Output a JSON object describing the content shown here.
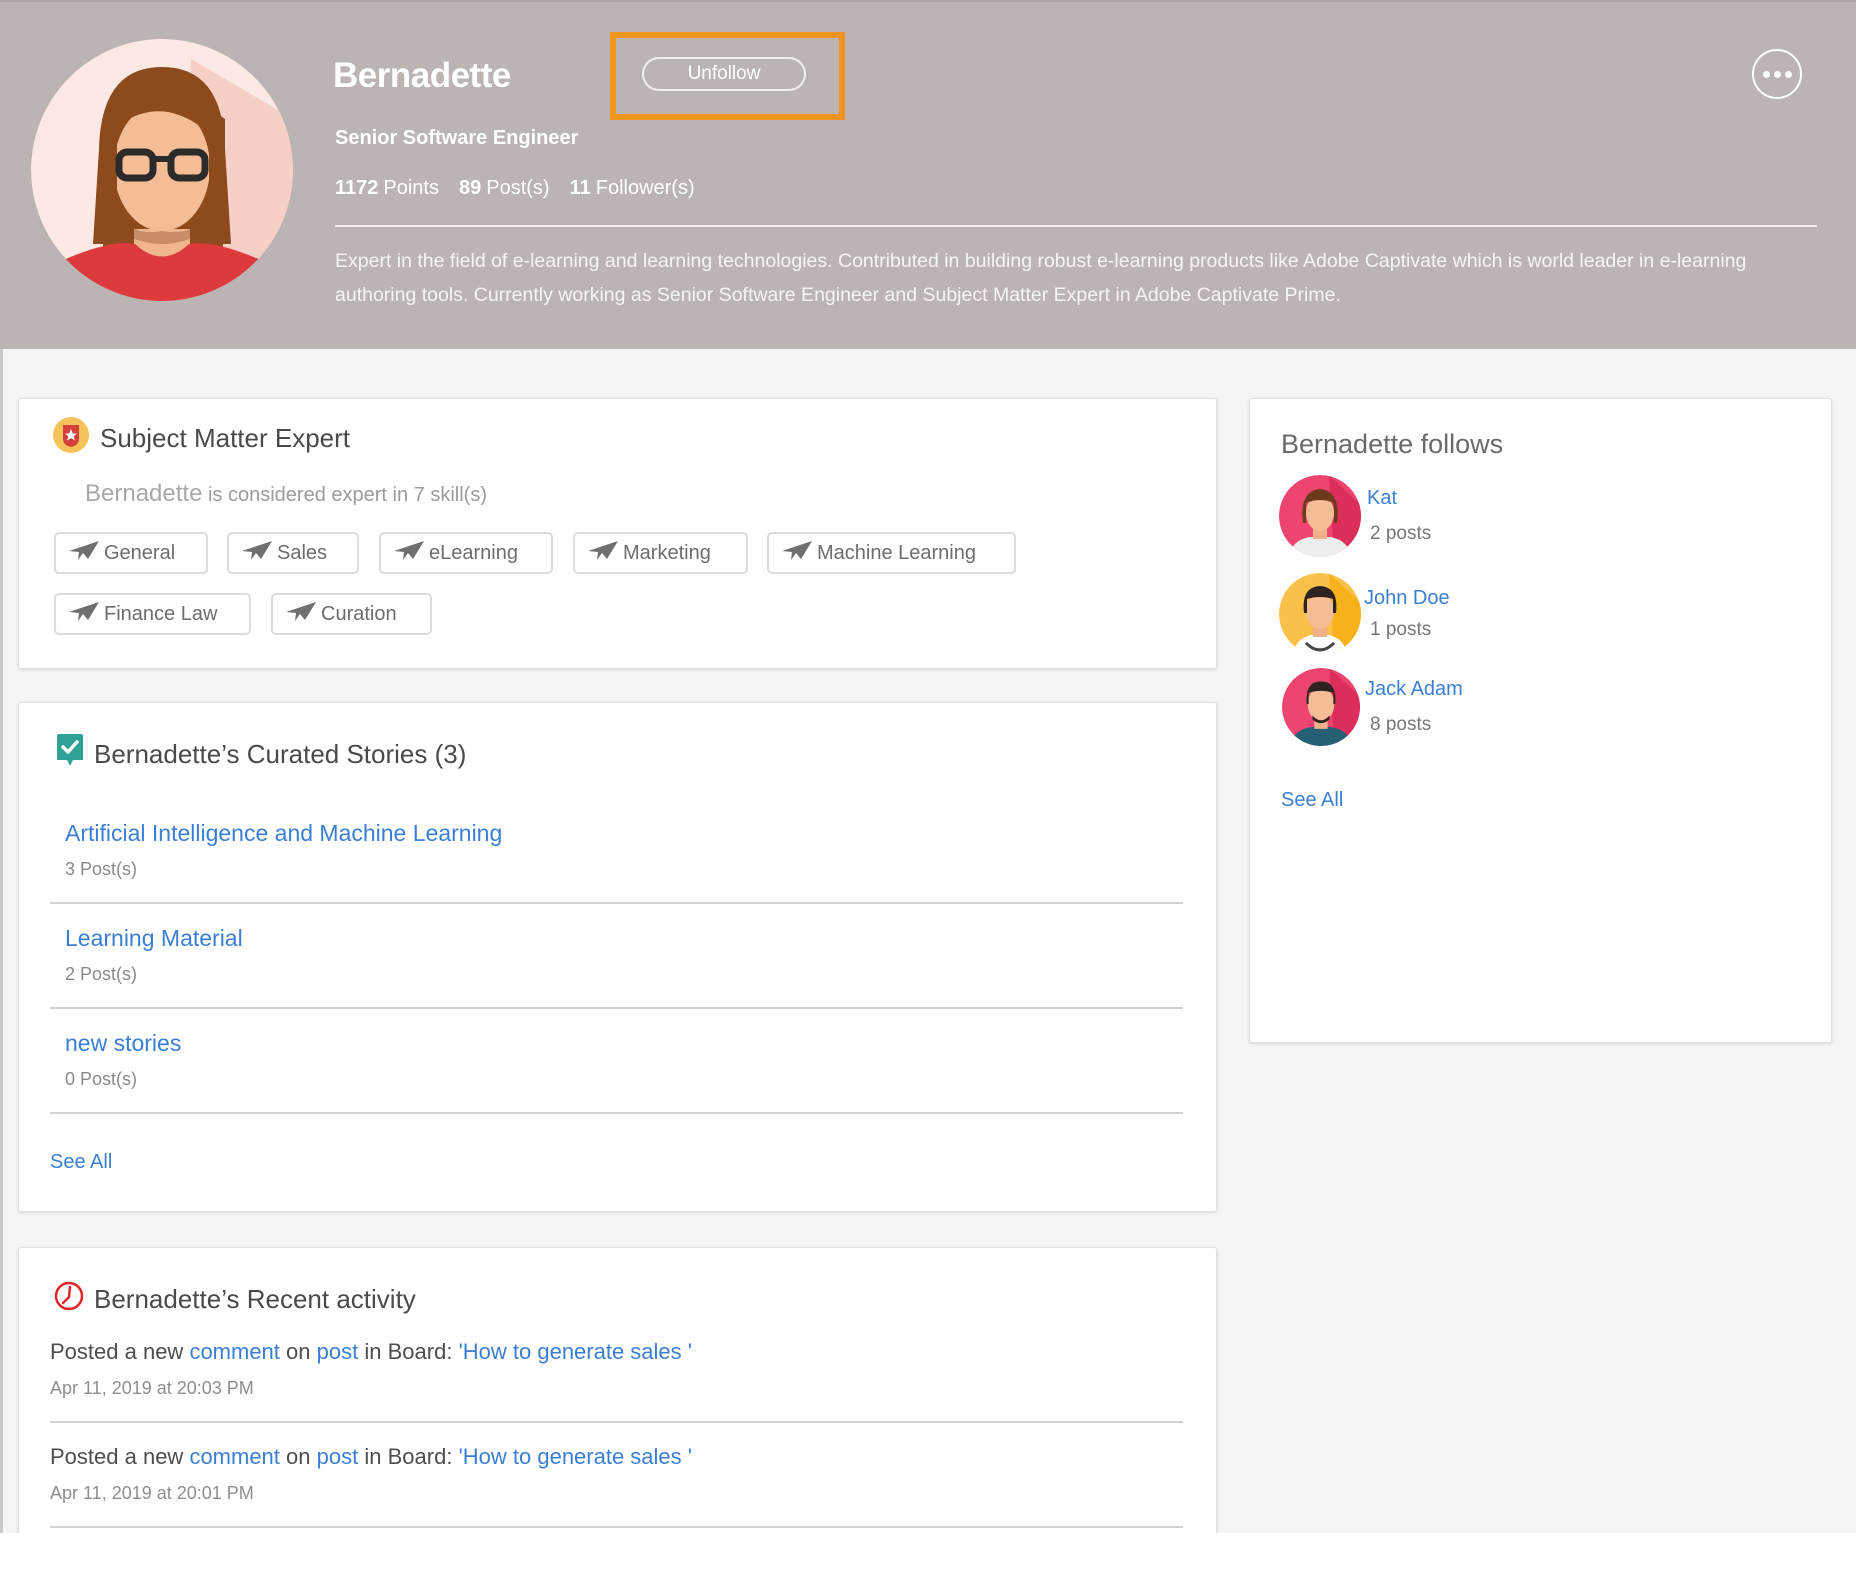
{
  "header": {
    "name": "Bernadette",
    "unfollow_label": "Unfollow",
    "more_icon": "more-horizontal-icon",
    "job_title": "Senior Software Engineer",
    "stats": [
      {
        "value": "1172",
        "label": "Points"
      },
      {
        "value": "89",
        "label": "Post(s)"
      },
      {
        "value": "11",
        "label": "Follower(s)"
      }
    ],
    "bio": "Expert in the field of e-learning and learning technologies. Contributed in building robust e-learning products like Adobe Captivate which is world leader in e-learning authoring tools. Currently working as Senior Software Engineer and Subject Matter Expert in Adobe Captivate Prime.",
    "highlight_color": "#f29420"
  },
  "sme": {
    "title": "Subject Matter Expert",
    "subject_name": "Bernadette",
    "subtitle": "is considered expert in 7 skill(s)",
    "skills": [
      "General",
      "Sales",
      "eLearning",
      "Marketing",
      "Machine Learning",
      "Finance Law",
      "Curation"
    ]
  },
  "curated": {
    "title": "Bernadette’s Curated Stories (3)",
    "stories": [
      {
        "title": "Artificial Intelligence and Machine Learning",
        "posts": "3 Post(s)"
      },
      {
        "title": "Learning Material",
        "posts": "2 Post(s)"
      },
      {
        "title": "new stories",
        "posts": "0 Post(s)"
      }
    ],
    "see_all": "See All"
  },
  "activity": {
    "title": "Bernadette’s Recent activity",
    "items": [
      {
        "prefix": "Posted a new",
        "comment": "comment",
        "on": "on",
        "post": "post",
        "in_board": "in Board:",
        "board": "'How to generate sales '",
        "date": "Apr 11, 2019 at 20:03 PM"
      },
      {
        "prefix": "Posted a new",
        "comment": "comment",
        "on": "on",
        "post": "post",
        "in_board": "in Board:",
        "board": "'How to generate sales '",
        "date": "Apr 11, 2019 at 20:01 PM"
      }
    ]
  },
  "follows": {
    "title": "Bernadette follows",
    "people": [
      {
        "name": "Kat",
        "posts": "2 posts"
      },
      {
        "name": "John Doe",
        "posts": "1 posts"
      },
      {
        "name": "Jack Adam",
        "posts": "8 posts"
      }
    ],
    "see_all": "See All"
  },
  "colors": {
    "header_bg": "#bcb4b2",
    "link": "#3b7fd4",
    "page_bg": "#f5f5f5"
  }
}
